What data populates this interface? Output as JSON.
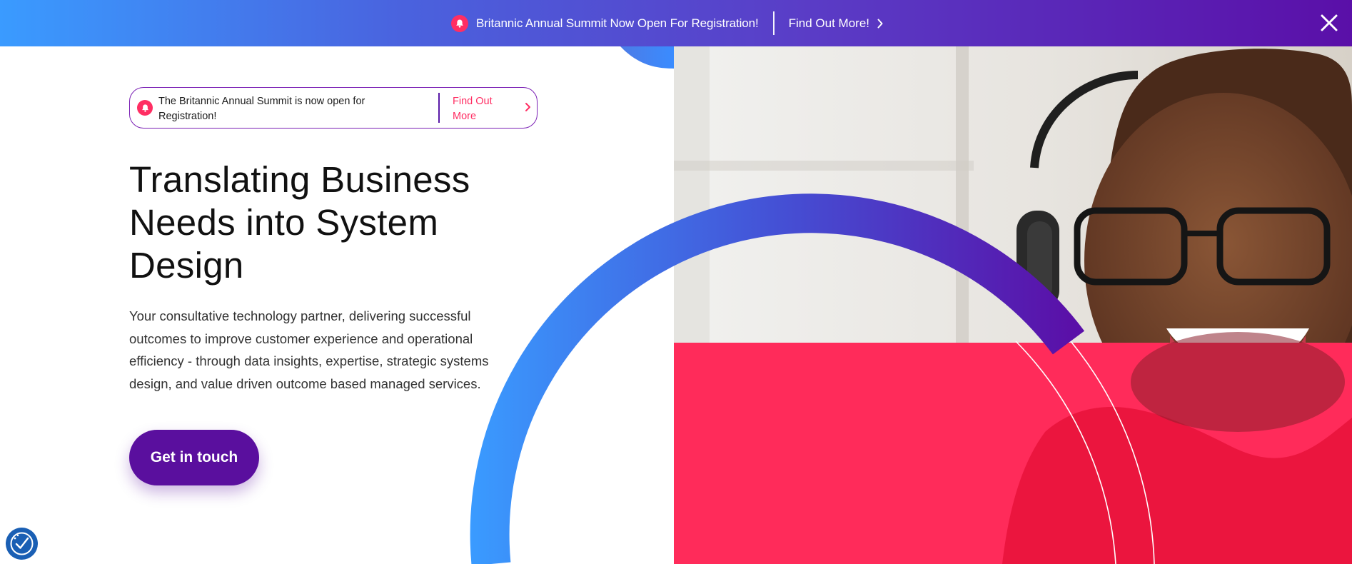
{
  "topbar": {
    "message": "Britannic Annual Summit Now Open For Registration!",
    "link_label": "Find Out More!",
    "icons": {
      "bell": "bell-icon",
      "chevron": "chevron-right-icon",
      "close": "close-icon"
    }
  },
  "announcement": {
    "text": "The Britannic Annual Summit is now open for Registration!",
    "link_label": "Find Out More"
  },
  "hero": {
    "headline": "Translating Business Needs into System Design",
    "description": "Your consultative technology partner, delivering successful outcomes to improve customer experience and operational efficiency - through data insights, expertise, strategic systems design, and value driven outcome based managed services.",
    "cta_label": "Get in touch"
  },
  "colors": {
    "accent_pink": "#ff2e63",
    "brand_purple": "#5a0f9e",
    "gradient_blue": "#3a9bff",
    "gradient_violet": "#5a0fa8"
  }
}
